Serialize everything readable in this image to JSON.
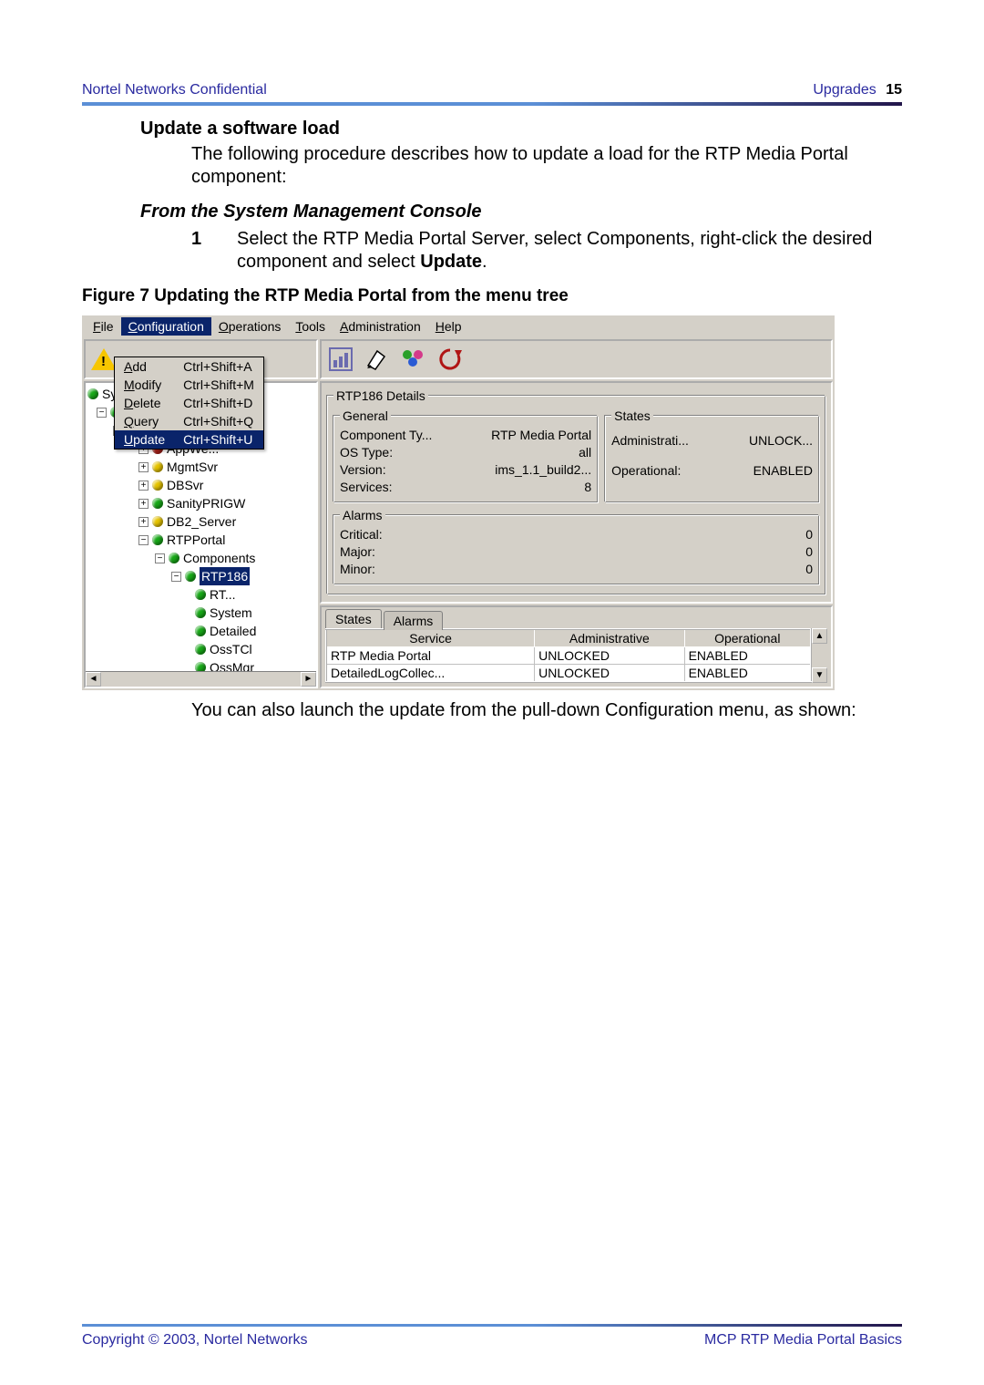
{
  "header": {
    "confidential": "Nortel Networks Confidential",
    "section": "Upgrades",
    "page": "15"
  },
  "footer": {
    "copyright": "Copyright © 2003, Nortel Networks",
    "doc": "MCP RTP Media Portal Basics"
  },
  "doc": {
    "h3": "Update a software load",
    "intro": "The following procedure describes how to update a load for the RTP Media Portal component:",
    "subhead": "From the System Management Console",
    "step1_num": "1",
    "step1a": "Select the RTP Media Portal Server, select Components, right-click the desired component and select ",
    "step1b": "Update",
    "step1c": ".",
    "fig_pre": "Figure 7  ",
    "figcap": "Updating the RTP Media Portal from the menu tree",
    "after": "You can also launch the update from the pull-down Configuration menu, as shown:"
  },
  "console": {
    "menubar": [
      {
        "label": "File",
        "u": "F",
        "sel": false
      },
      {
        "label": "Configuration",
        "u": "C",
        "sel": true
      },
      {
        "label": "Operations",
        "u": "O",
        "sel": false
      },
      {
        "label": "Tools",
        "u": "T",
        "sel": false
      },
      {
        "label": "Administration",
        "u": "A",
        "sel": false
      },
      {
        "label": "Help",
        "u": "H",
        "sel": false
      }
    ],
    "dropdown": [
      {
        "label": "Add",
        "u": "A",
        "accel": "Ctrl+Shift+A",
        "sel": false
      },
      {
        "label": "Modify",
        "u": "M",
        "accel": "Ctrl+Shift+M",
        "sel": false
      },
      {
        "label": "Delete",
        "u": "D",
        "accel": "Ctrl+Shift+D",
        "sel": false
      },
      {
        "label": "Query",
        "u": "Q",
        "accel": "Ctrl+Shift+Q",
        "sel": false
      },
      {
        "label": "Update",
        "u": "U",
        "accel": "Ctrl+Shift+U",
        "sel": true
      }
    ],
    "tree": {
      "root": {
        "label": "Sy",
        "dot": "g",
        "exp": "−"
      },
      "site": {
        "label": "",
        "dot": "g",
        "exp": "−"
      },
      "items": [
        {
          "exp": "+",
          "dot": "r",
          "label": "AppWe..."
        },
        {
          "exp": "+",
          "dot": "y",
          "label": "MgmtSvr"
        },
        {
          "exp": "+",
          "dot": "y",
          "label": "DBSvr"
        },
        {
          "exp": "+",
          "dot": "g",
          "label": "SanityPRIGW"
        },
        {
          "exp": "+",
          "dot": "y",
          "label": "DB2_Server"
        },
        {
          "exp": "−",
          "dot": "g",
          "label": "RTPPortal"
        }
      ],
      "components_label": "Components",
      "selected": "RTP186",
      "children": [
        "RT...",
        "System",
        "Detailed",
        "OssTCl",
        "OssMgr"
      ]
    },
    "toolbar_icons": [
      "chart",
      "note",
      "users",
      "refresh"
    ],
    "details": {
      "title": "RTP186 Details",
      "general_label": "General",
      "general": [
        {
          "k": "Component Ty...",
          "v": "RTP Media Portal"
        },
        {
          "k": "OS Type:",
          "v": "all"
        },
        {
          "k": "Version:",
          "v": "ims_1.1_build2..."
        },
        {
          "k": "Services:",
          "v": "8"
        }
      ],
      "states_label": "States",
      "states": [
        {
          "k": "Administrati...",
          "v": "UNLOCK..."
        },
        {
          "k": "Operational:",
          "v": "ENABLED"
        }
      ],
      "alarms_label": "Alarms",
      "alarms": [
        {
          "k": "Critical:",
          "v": "0"
        },
        {
          "k": "Major:",
          "v": "0"
        },
        {
          "k": "Minor:",
          "v": "0"
        }
      ]
    },
    "tabs": {
      "states": "States",
      "alarms": "Alarms"
    },
    "grid": {
      "headers": [
        "Service",
        "Administrative",
        "Operational"
      ],
      "rows": [
        [
          "RTP Media Portal",
          "UNLOCKED",
          "ENABLED"
        ],
        [
          "DetailedLogCollec...",
          "UNLOCKED",
          "ENABLED"
        ]
      ]
    }
  }
}
